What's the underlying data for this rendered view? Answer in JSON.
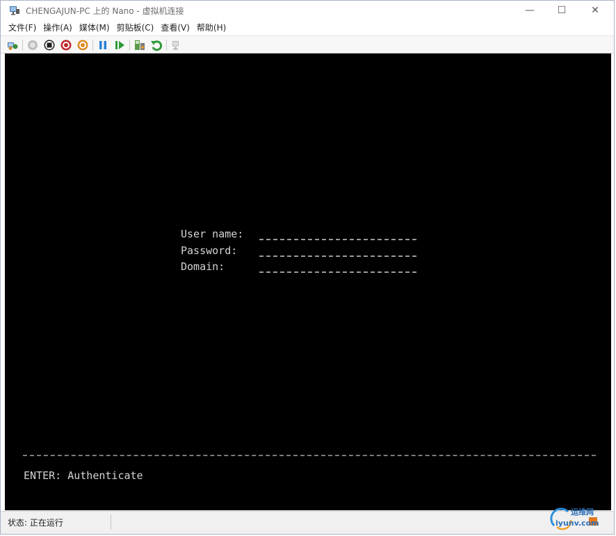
{
  "window": {
    "title": "CHENGAJUN-PC 上的 Nano - 虚拟机连接",
    "controls": {
      "minimize": "—",
      "maximize": "☐",
      "close": "✕"
    }
  },
  "menu": [
    {
      "label": "文件(F)"
    },
    {
      "label": "操作(A)"
    },
    {
      "label": "媒体(M)"
    },
    {
      "label": "剪贴板(C)"
    },
    {
      "label": "查看(V)"
    },
    {
      "label": "帮助(H)"
    }
  ],
  "toolbar": {
    "icons": [
      "ctrl-alt-del-icon",
      "start-icon",
      "turn-off-icon",
      "shut-down-icon",
      "save-icon",
      "pause-icon",
      "reset-icon",
      "checkpoint-icon",
      "revert-icon",
      "enhanced-session-icon"
    ]
  },
  "console": {
    "username_label": "User name:",
    "password_label": "Password:",
    "domain_label": "Domain:",
    "hint": "ENTER: Authenticate"
  },
  "status": {
    "text": "状态: 正在运行"
  },
  "watermark": {
    "top": "运维网",
    "bottom": "iyunv.com"
  },
  "colors": {
    "screen_bg": "#000000",
    "console_text": "#d4d4d4",
    "accent_blue": "#2d6fb6"
  }
}
